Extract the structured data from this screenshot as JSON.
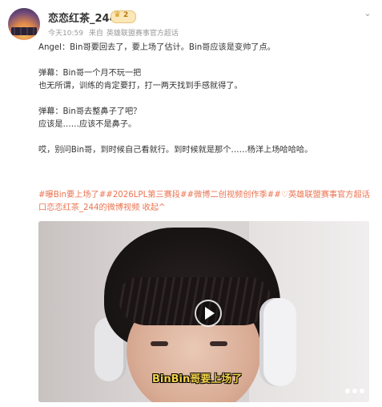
{
  "post": {
    "username": "恋恋红茶_244",
    "badge_level": "2",
    "time": "今天10:59",
    "source_prefix": "来自",
    "source": "英雄联盟赛事官方超话",
    "more_icon": "chevron-down-icon"
  },
  "body": {
    "lines": [
      "Angel：Bin哥要回去了，要上场了估计。Bin哥应该是变帅了点。",
      "",
      "弹幕：Bin哥一个月不玩一把",
      "也无所谓，训练的肯定要打，打一两天找到手感就得了。",
      "",
      "弹幕：Bin哥去整鼻子了吧？",
      "应该是……应该不是鼻子。",
      "",
      "哎，别问Bin哥，到时候自己看就行。到时候就是那个……杨洋上场哈哈哈。"
    ]
  },
  "hashtags": {
    "line1": "#曝Bin要上场了##2026LPL第三赛段##微博二创视频创作季##♡英雄联盟赛事官方超话",
    "line2": "口恋恋红茶_244的微博视频 收起^"
  },
  "video": {
    "subtitle": "BinBin哥要上场了",
    "play_icon": "play-icon"
  },
  "colors": {
    "accent": "#eb7350",
    "username": "#333333",
    "meta": "#999999",
    "subtitle": "#f4d34b"
  }
}
